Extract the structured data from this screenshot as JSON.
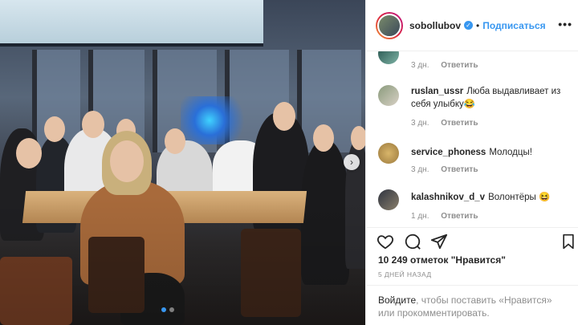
{
  "post": {
    "username": "sobollubov",
    "separator": "•",
    "follow_label": "Подписаться",
    "more_label": "•••"
  },
  "comments": [
    {
      "user": "",
      "text": "",
      "time": "3 дн.",
      "reply": "Ответить"
    },
    {
      "user": "ruslan_ussr",
      "text": "Люба выдавливает из себя улыбку😂",
      "time": "3 дн.",
      "reply": "Ответить"
    },
    {
      "user": "service_phoness",
      "text": "Молодцы!",
      "time": "3 дн.",
      "reply": "Ответить"
    },
    {
      "user": "kalashnikov_d_v",
      "text": "Волонтёры 😆",
      "time": "1 дн.",
      "reply": "Ответить"
    }
  ],
  "likes_text": "10 249 отметок \"Нравится\"",
  "date_text": "5 ДНЕЙ НАЗАД",
  "login": {
    "link": "Войдите",
    "text": ", чтобы поставить «Нравится» или прокомментировать."
  },
  "carousel": {
    "next_icon": "chevron-right-icon",
    "current": 1,
    "total": 2
  },
  "colors": {
    "accent": "#3897f0",
    "muted": "#8e8e8e",
    "text": "#262626"
  }
}
